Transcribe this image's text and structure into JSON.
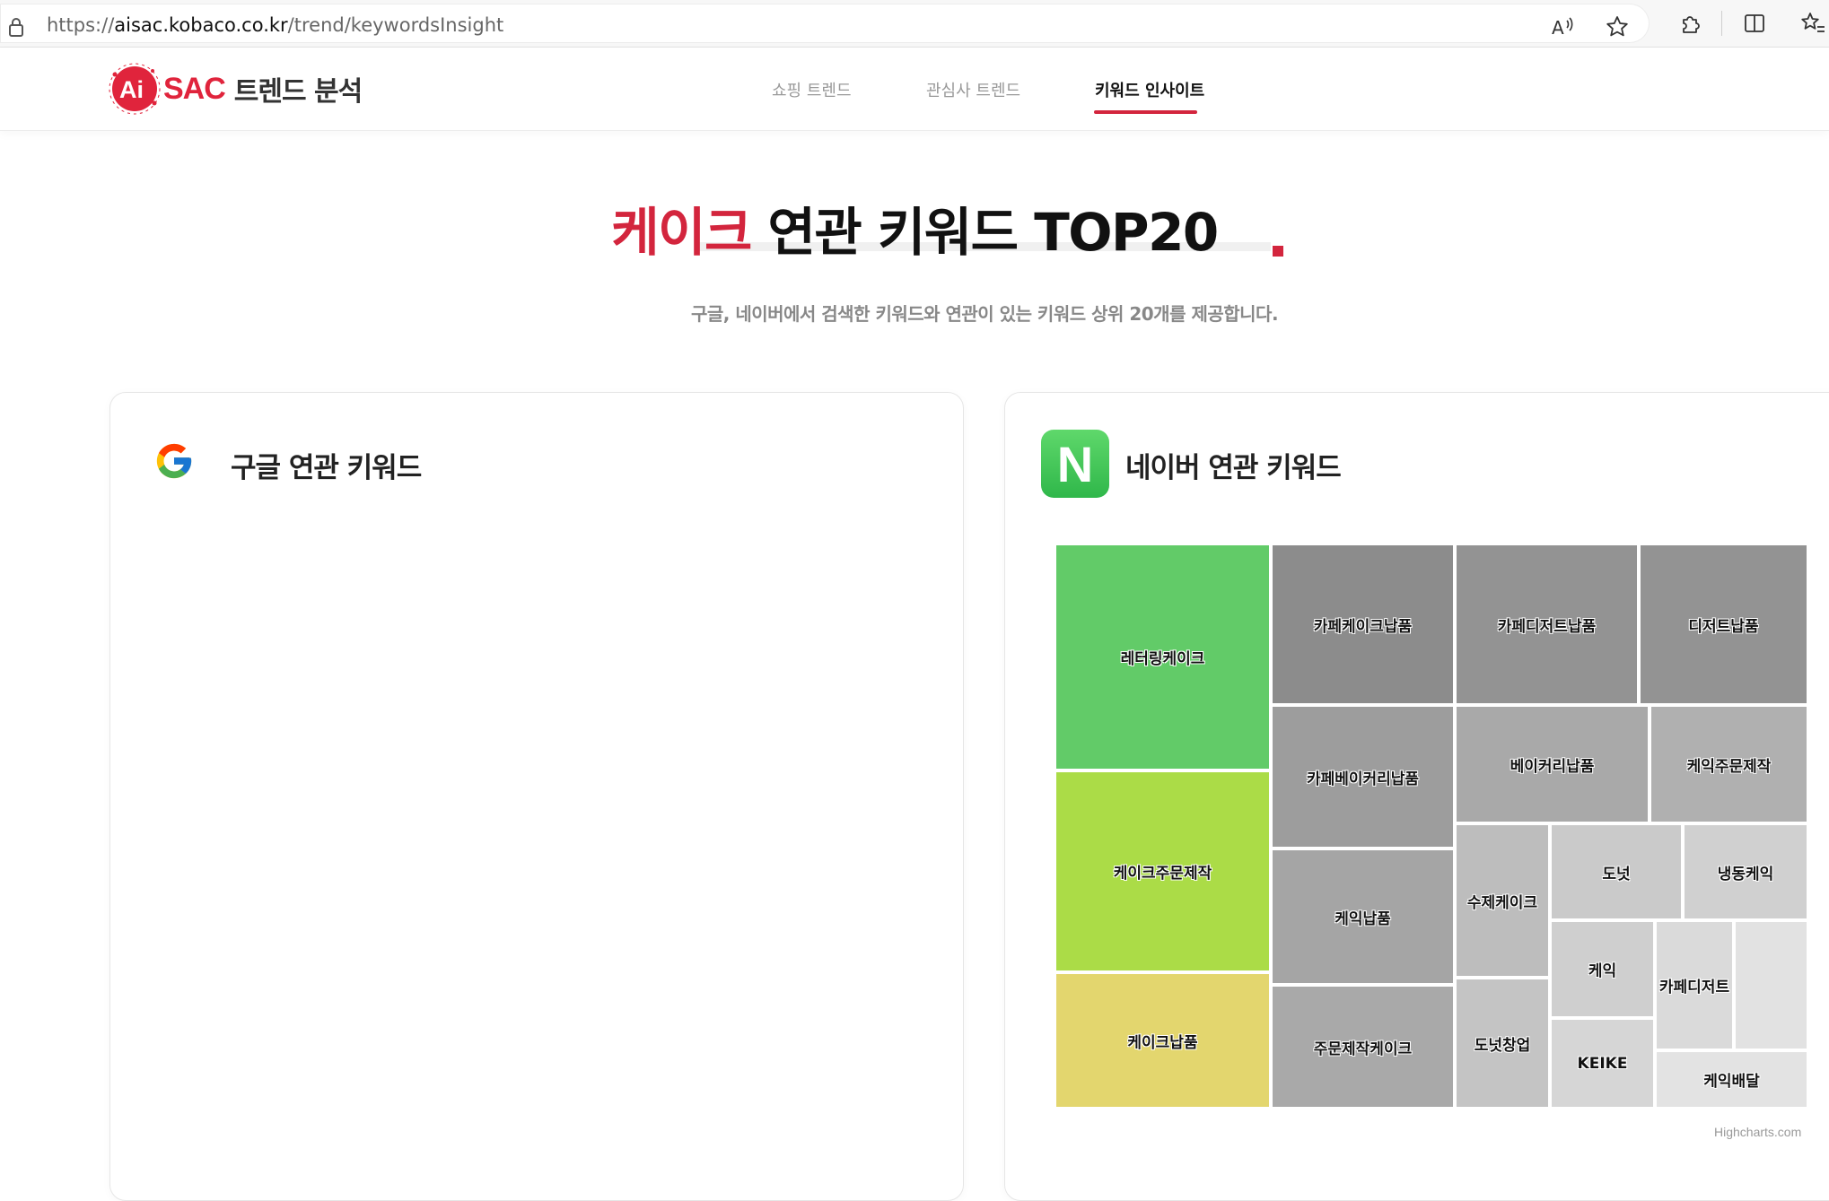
{
  "browser": {
    "url_scheme": "https://",
    "url_host": "aisac.kobaco.co.kr",
    "url_path": "/trend/keywordsInsight"
  },
  "header": {
    "logo_letters": "Ai",
    "logo_sac": "SAC",
    "logo_text": "트렌드 분석",
    "nav": [
      {
        "label": "쇼핑 트렌드",
        "active": false
      },
      {
        "label": "관심사 트렌드",
        "active": false
      },
      {
        "label": "키워드 인사이트",
        "active": true
      }
    ]
  },
  "hero": {
    "keyword": "케이크",
    "title_rest": " 연관 키워드 TOP20",
    "subtitle": "구글, 네이버에서 검색한 키워드와 연관이 있는 키워드 상위 20개를 제공합니다."
  },
  "google_card": {
    "title": "구글 연관 키워드"
  },
  "naver_card": {
    "title": "네이버 연관 키워드",
    "icon_letter": "N"
  },
  "colors": {
    "accent": "#d3253d",
    "naver_green": "#2fb74a"
  },
  "treemap": {
    "credits": "Highcharts.com",
    "cells": [
      {
        "label": "레터링케이크",
        "color": "#62cb68"
      },
      {
        "label": "케이크주문제작",
        "color": "#abdc47"
      },
      {
        "label": "케이크납품",
        "color": "#e3d66e"
      },
      {
        "label": "카페케이크납품",
        "color": "#8c8c8c"
      },
      {
        "label": "카페디저트납품",
        "color": "#939393"
      },
      {
        "label": "디저트납품",
        "color": "#939393"
      },
      {
        "label": "카페베이커리납품",
        "color": "#9d9d9d"
      },
      {
        "label": "베이커리납품",
        "color": "#a9a9a9"
      },
      {
        "label": "케익주문제작",
        "color": "#b0b0b0"
      },
      {
        "label": "케익납품",
        "color": "#a5a5a5"
      },
      {
        "label": "주문제작케이크",
        "color": "#a9a9a9"
      },
      {
        "label": "수제케이크",
        "color": "#bdbdbd"
      },
      {
        "label": "도넛",
        "color": "#cacaca"
      },
      {
        "label": "냉동케익",
        "color": "#d0d0d0"
      },
      {
        "label": "도넛창업",
        "color": "#c4c4c4"
      },
      {
        "label": "케익",
        "color": "#cfcfcf"
      },
      {
        "label": "카페디저트",
        "color": "#dadada"
      },
      {
        "label": "",
        "color": "#e2e2e2"
      },
      {
        "label": "KEIKE",
        "color": "#d6d6d6"
      },
      {
        "label": "케익배달",
        "color": "#e3e3e3"
      }
    ]
  }
}
